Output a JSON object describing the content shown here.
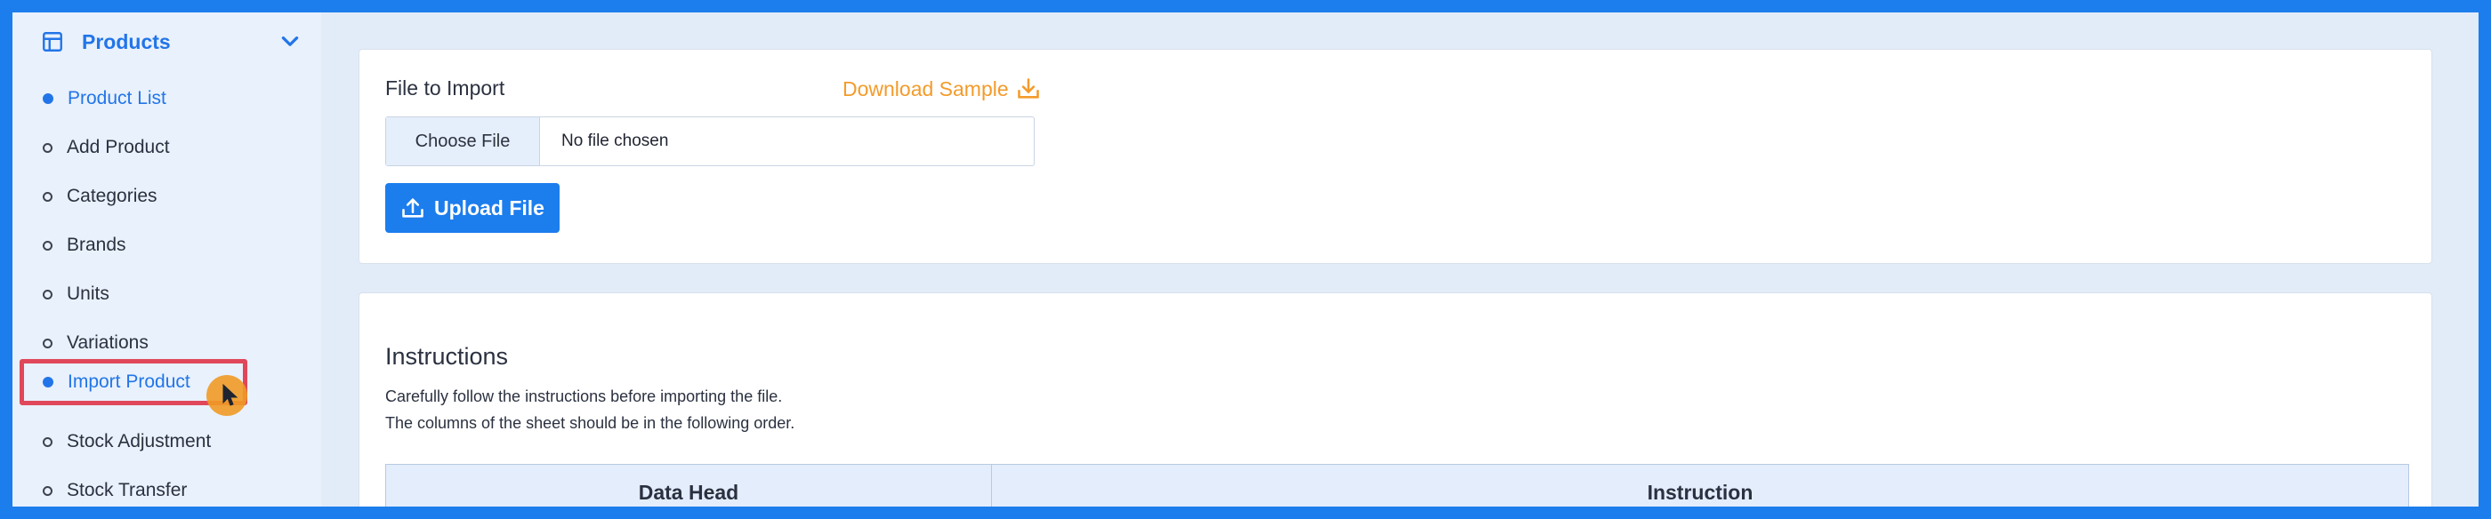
{
  "sidebar": {
    "section_title": "Products",
    "items": [
      {
        "label": "Product List",
        "active": true
      },
      {
        "label": "Add Product",
        "active": false
      },
      {
        "label": "Categories",
        "active": false
      },
      {
        "label": "Brands",
        "active": false
      },
      {
        "label": "Units",
        "active": false
      },
      {
        "label": "Variations",
        "active": false
      },
      {
        "label": "Import Product",
        "active": true
      },
      {
        "label": "Stock Adjustment",
        "active": false
      },
      {
        "label": "Stock Transfer",
        "active": false
      }
    ]
  },
  "import_card": {
    "file_label": "File to Import",
    "download_sample": "Download Sample",
    "choose_file": "Choose File",
    "no_file": "No file chosen",
    "upload_button": "Upload File"
  },
  "instructions": {
    "title": "Instructions",
    "line1": "Carefully follow the instructions before importing the file.",
    "line2": "The columns of the sheet should be in the following order.",
    "columns": [
      "Data Head",
      "Instruction"
    ]
  },
  "colors": {
    "accent": "#1c7ded",
    "orange": "#f39b2b",
    "highlight": "#e0475a"
  }
}
